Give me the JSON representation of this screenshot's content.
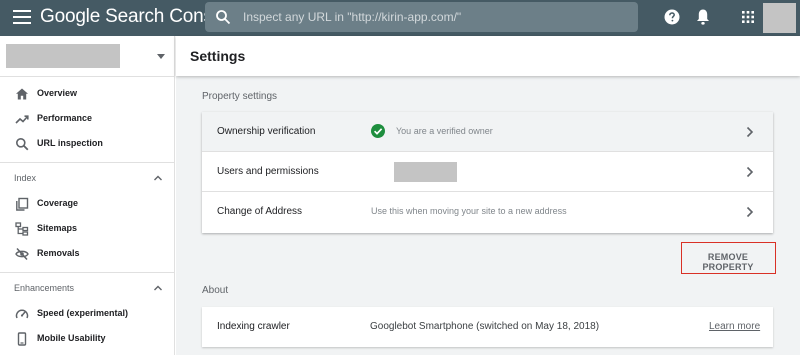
{
  "app": {
    "title": "Google Search Console"
  },
  "search": {
    "placeholder": "Inspect any URL in \"http://kirin-app.com/\""
  },
  "sidebar": {
    "items": [
      {
        "label": "Overview",
        "icon": "home-icon"
      },
      {
        "label": "Performance",
        "icon": "trending-up-icon"
      },
      {
        "label": "URL inspection",
        "icon": "search-icon"
      }
    ],
    "sections": [
      {
        "label": "Index",
        "items": [
          {
            "label": "Coverage",
            "icon": "copy-icon"
          },
          {
            "label": "Sitemaps",
            "icon": "sitemap-icon"
          },
          {
            "label": "Removals",
            "icon": "visibility-off-icon"
          }
        ]
      },
      {
        "label": "Enhancements",
        "items": [
          {
            "label": "Speed (experimental)",
            "icon": "speed-icon"
          },
          {
            "label": "Mobile Usability",
            "icon": "phone-icon"
          }
        ]
      }
    ]
  },
  "main": {
    "title": "Settings",
    "property_settings": {
      "label": "Property settings",
      "rows": [
        {
          "label": "Ownership verification",
          "value": "You are a verified owner"
        },
        {
          "label": "Users and permissions",
          "value": ""
        },
        {
          "label": "Change of Address",
          "value": "Use this when moving your site to a new address"
        }
      ]
    },
    "remove_button": "REMOVE PROPERTY",
    "about": {
      "label": "About",
      "rows": [
        {
          "label": "Indexing crawler",
          "value": "Googlebot Smartphone (switched on May 18, 2018)",
          "link": "Learn more"
        }
      ]
    }
  },
  "colors": {
    "topbar": "#455a64",
    "verified_green": "#1e8e3e",
    "highlight_red": "#d93025",
    "page_bg": "#f1f3f4"
  }
}
